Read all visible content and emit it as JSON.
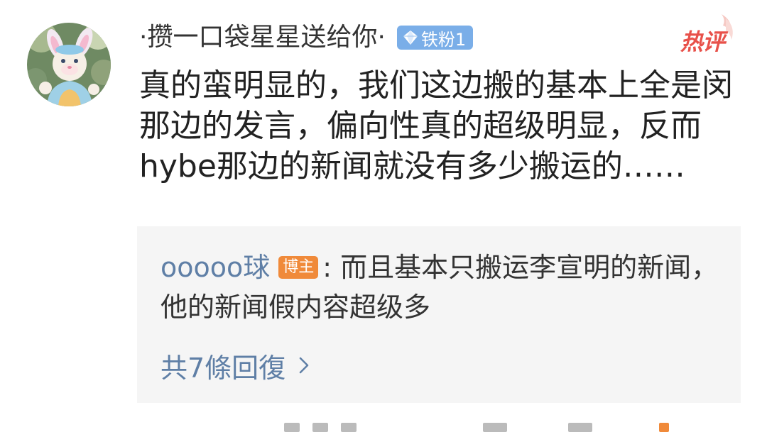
{
  "comment": {
    "username": "·攒一口袋星星送给你·",
    "fan_badge": "铁粉1",
    "hot_tag": "热评",
    "text": "真的蛮明显的，我们这边搬的基本上全是闵那边的发言，偏向性真的超级明显，反而hybe那边的新闻就没有多少搬运的……"
  },
  "reply": {
    "username": "ooooo球",
    "host_badge": "博主",
    "separator": ":",
    "text": " 而且基本只搬运李宣明的新闻，他的新闻假内容超级多",
    "reply_count": "共7條回復"
  },
  "colors": {
    "link": "#5f7fa6",
    "hot": "#e8514a",
    "fan_badge": "#7aaee8",
    "host_badge": "#f08a3a",
    "reply_bg": "#f5f5f5"
  },
  "icons": {
    "fan_badge": "diamond-icon",
    "reply_more": "chevron-right-icon"
  }
}
